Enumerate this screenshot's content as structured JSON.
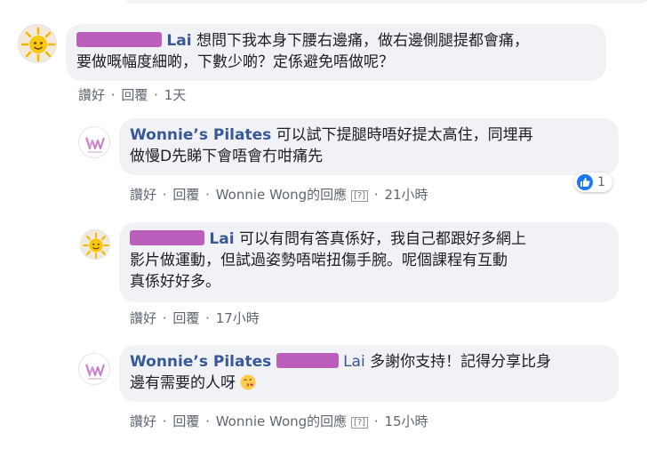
{
  "comments": [
    {
      "name": "Lai",
      "text": "想問下我本身下腰右邊痛，做右邊側腿提都會痛，要做嘅幅度細啲，下數少啲？定係避免唔做呢？",
      "line1": "想問下我本身下腰右邊痛，做右邊側腿提都會痛，",
      "line2": "要做嘅幅度細啲，下數少啲？定係避免唔做呢？",
      "like": "讚好",
      "reply": "回覆",
      "time": "1天"
    },
    {
      "name": "Wonnie’s Pilates",
      "line1": "可以試下提腿時唔好提太高住，同埋再",
      "line2": "做慢D先睇下會唔會冇咁痛先",
      "like": "讚好",
      "reply": "回覆",
      "replied_by": "Wonnie Wong的回應",
      "help": "[?]",
      "time": "21小時",
      "reaction_count": "1",
      "reaction_icon": "like-icon"
    },
    {
      "name": "Lai",
      "line1": "可以有問有答真係好，我自己都跟好多網上",
      "line2": "影片做運動，但試過姿勢唔啱扭傷手腕。呢個課程有互動",
      "line3": "真係好好多。",
      "like": "讚好",
      "reply": "回覆",
      "time": "17小時"
    },
    {
      "name": "Wonnie’s Pilates",
      "mention": "Lai",
      "line1": "多謝你支持！記得分享比身",
      "line2": "邊有需要的人呀",
      "emoji": "kiss-heart-emoji",
      "like": "讚好",
      "reply": "回覆",
      "replied_by": "Wonnie Wong的回應",
      "help": "[?]",
      "time": "15小時"
    }
  ],
  "separator": "·",
  "colors": {
    "name": "#385898",
    "bubble": "#f0f2f5",
    "redaction": "#b54fb6",
    "like": "#1877f2"
  }
}
